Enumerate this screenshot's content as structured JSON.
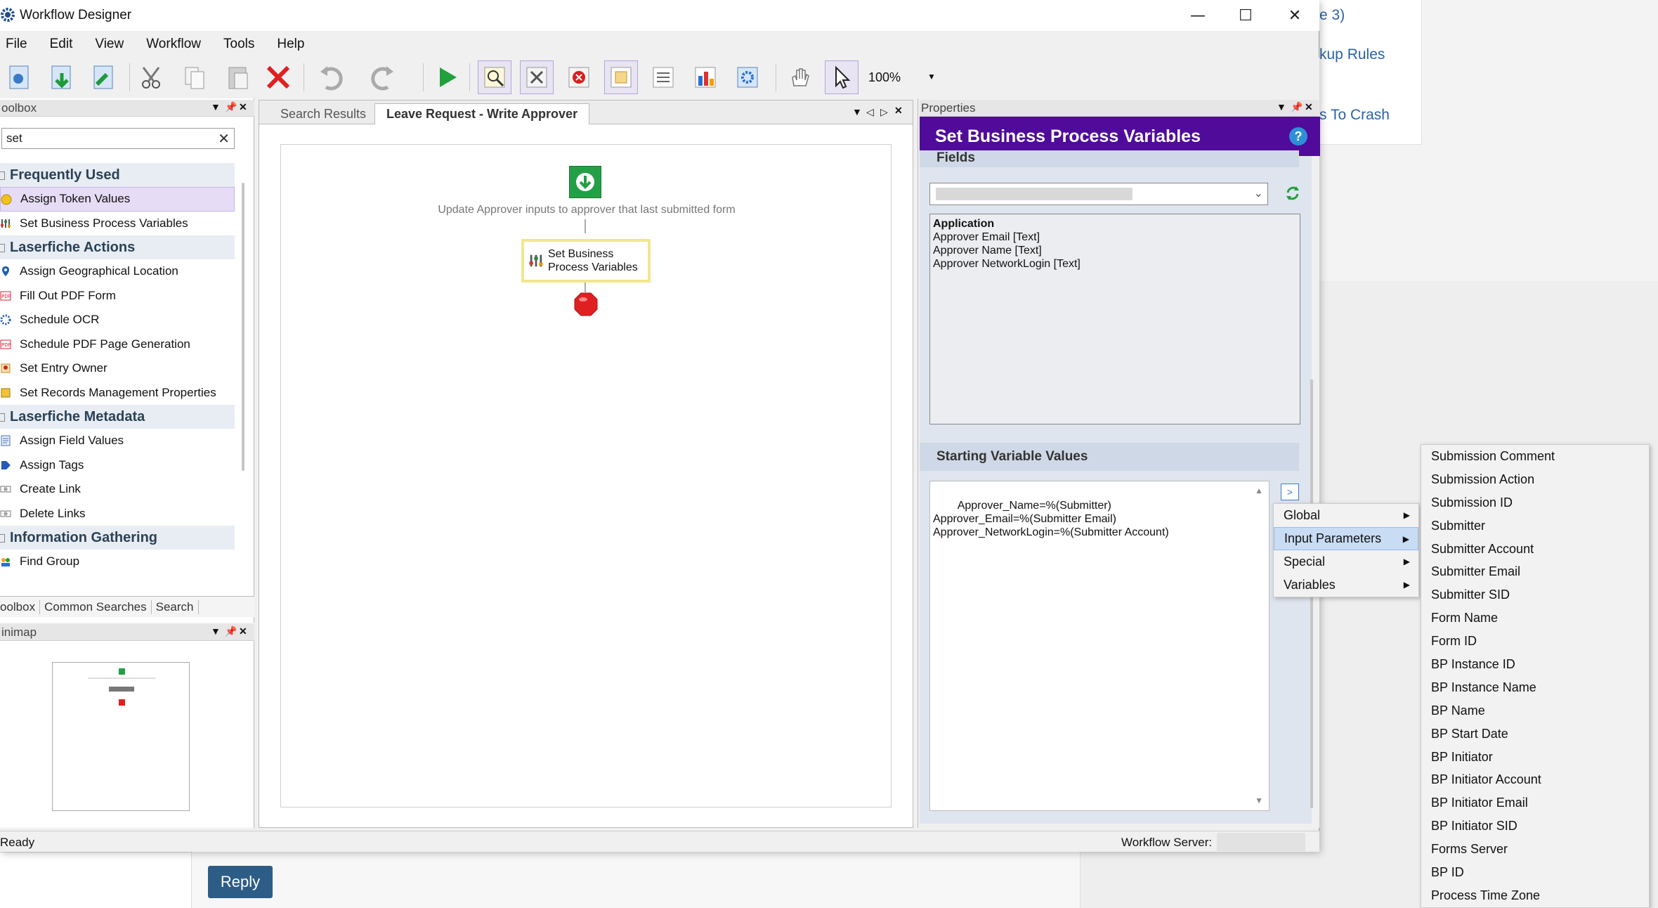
{
  "background": {
    "links": [
      "e 3)",
      "kup Rules",
      "s To Crash"
    ],
    "reply_label": "Reply"
  },
  "window": {
    "title": "Workflow Designer",
    "controls": {
      "minimize": "—",
      "maximize": "☐",
      "close": "✕"
    }
  },
  "menu": [
    "File",
    "Edit",
    "View",
    "Workflow",
    "Tools",
    "Help"
  ],
  "toolbar": {
    "zoom": "100%"
  },
  "toolbox": {
    "header": "oolbox",
    "search_value": "set",
    "categories": [
      {
        "name": "Frequently Used",
        "items": [
          "Assign Token Values",
          "Set Business Process Variables"
        ]
      },
      {
        "name": "Laserfiche Actions",
        "items": [
          "Assign Geographical Location",
          "Fill Out PDF Form",
          "Schedule OCR",
          "Schedule PDF Page Generation",
          "Set Entry Owner",
          "Set Records Management Properties"
        ]
      },
      {
        "name": "Laserfiche Metadata",
        "items": [
          "Assign Field Values",
          "Assign Tags",
          "Create Link",
          "Delete Links"
        ]
      },
      {
        "name": "Information Gathering",
        "items": [
          "Find Group"
        ]
      }
    ],
    "tabs": [
      "oolbox",
      "Common Searches",
      "Search"
    ]
  },
  "minimap": {
    "header": "inimap"
  },
  "designer": {
    "tabs": [
      "Search Results",
      "Leave Request - Write Approver"
    ],
    "start_label": "Update Approver inputs to approver that last submitted form",
    "activity_label_line1": "Set Business",
    "activity_label_line2": "Process Variables"
  },
  "properties": {
    "header": "Properties",
    "title": "Set Business Process Variables",
    "help": "?",
    "fields_section": "Fields",
    "field_list": [
      "Application",
      "Approver Email [Text]",
      "Approver Name [Text]",
      "Approver NetworkLogin [Text]"
    ],
    "starting_section": "Starting Variable Values",
    "starting_values": "Approver_Name=%(Submitter)\nApprover_Email=%(Submitter Email)\nApprover_NetworkLogin=%(Submitter Account)",
    "insert_btn": ">"
  },
  "context_menu": {
    "items": [
      "Global",
      "Input Parameters",
      "Special",
      "Variables"
    ],
    "highlighted": "Input Parameters"
  },
  "submenu": {
    "items": [
      "Submission Comment",
      "Submission Action",
      "Submission ID",
      "Submitter",
      "Submitter Account",
      "Submitter Email",
      "Submitter SID",
      "Form Name",
      "Form ID",
      "BP Instance ID",
      "BP Instance Name",
      "BP Name",
      "BP Start Date",
      "BP Initiator",
      "BP Initiator Account",
      "BP Initiator Email",
      "BP Initiator SID",
      "Forms Server",
      "BP ID",
      "Process Time Zone"
    ]
  },
  "status": {
    "left": "Ready",
    "server_label": "Workflow Server:"
  },
  "colors": {
    "title_bar": "#500b9a",
    "start": "#23a046",
    "stop": "#e02020",
    "highlight": "#c8dcf4"
  }
}
